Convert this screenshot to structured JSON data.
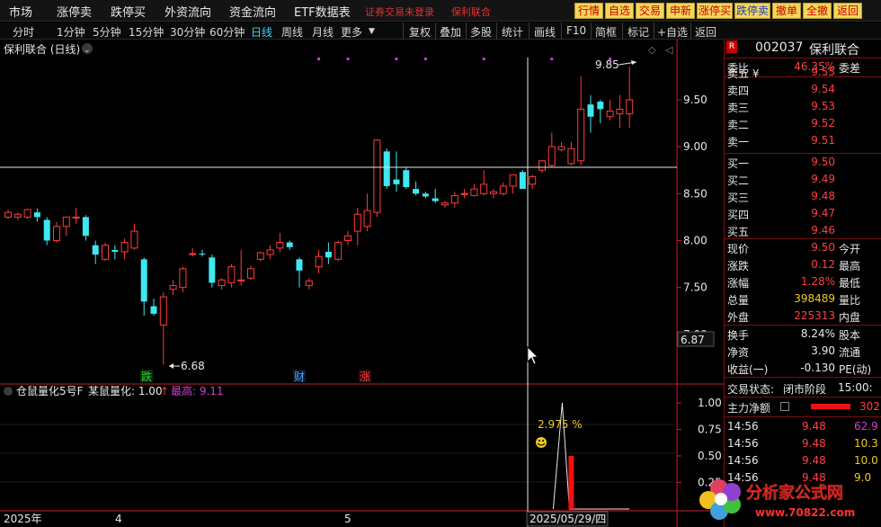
{
  "menubar": {
    "items": [
      "市场",
      "涨停卖",
      "跌停买",
      "外资流向",
      "资金流向",
      "ETF数据表"
    ],
    "notice": "证券交易未登录",
    "stock_tag": "保利联合",
    "buttons": [
      "行情",
      "自选",
      "交易",
      "申新",
      "涨停买",
      "跌停卖",
      "撤单",
      "全撤",
      "返回"
    ]
  },
  "periodbar": {
    "periods": [
      "分时",
      "1分钟",
      "5分钟",
      "15分钟",
      "30分钟",
      "60分钟",
      "日线",
      "周线",
      "月线",
      "更多"
    ],
    "active": "日线",
    "tools": [
      "复权",
      "叠加",
      "多股",
      "统计",
      "画线",
      "F10",
      "简框",
      "标记",
      "+自选",
      "返回"
    ]
  },
  "main_chart": {
    "title": "保利联合 (日线)",
    "high_label": "9.85",
    "low_label": "6.68",
    "crosshair_price": "6.87",
    "markers": [
      "跌",
      "财",
      "涨"
    ]
  },
  "indicator": {
    "name": "仓鼠量化5号F",
    "label1": "某鼠量化: 1.00",
    "arrow": "↑",
    "label2": "最高: 9.11",
    "peak_text": "2.975 %",
    "face": "☺"
  },
  "date_axis": [
    "2025年",
    "4",
    "5"
  ],
  "cursor_date": "2025/05/29/四",
  "colors": {
    "up": "#ff3c3c",
    "down": "#3fe7f0",
    "axis": "#c8202a",
    "ma_dot": "#c040d0",
    "indicator_bar": "#ee1111"
  },
  "chart_data": [
    {
      "type": "candlestick",
      "title": "保利联合 (日线)",
      "y_ticks": [
        7.0,
        7.5,
        8.0,
        8.5,
        9.0,
        9.5
      ],
      "ylim": [
        6.5,
        9.95
      ],
      "candles": [
        {
          "o": 8.25,
          "h": 8.33,
          "l": 8.23,
          "c": 8.3
        },
        {
          "o": 8.25,
          "h": 8.3,
          "l": 8.22,
          "c": 8.28
        },
        {
          "o": 8.25,
          "h": 8.34,
          "l": 8.23,
          "c": 8.33
        },
        {
          "o": 8.3,
          "h": 8.34,
          "l": 8.2,
          "c": 8.25
        },
        {
          "o": 8.22,
          "h": 8.25,
          "l": 7.95,
          "c": 8.0
        },
        {
          "o": 8.0,
          "h": 8.2,
          "l": 7.98,
          "c": 8.15
        },
        {
          "o": 8.15,
          "h": 8.25,
          "l": 8.05,
          "c": 8.25
        },
        {
          "o": 8.25,
          "h": 8.35,
          "l": 8.18,
          "c": 8.25
        },
        {
          "o": 8.25,
          "h": 8.27,
          "l": 8.0,
          "c": 8.05
        },
        {
          "o": 7.95,
          "h": 8.0,
          "l": 7.75,
          "c": 7.85
        },
        {
          "o": 7.8,
          "h": 7.98,
          "l": 7.78,
          "c": 7.95
        },
        {
          "o": 7.9,
          "h": 7.95,
          "l": 7.8,
          "c": 7.88
        },
        {
          "o": 7.88,
          "h": 8.02,
          "l": 7.8,
          "c": 7.98
        },
        {
          "o": 7.92,
          "h": 8.18,
          "l": 7.9,
          "c": 8.1
        },
        {
          "o": 7.8,
          "h": 7.82,
          "l": 7.2,
          "c": 7.35
        },
        {
          "o": 7.3,
          "h": 7.38,
          "l": 7.2,
          "c": 7.22
        },
        {
          "o": 7.1,
          "h": 7.45,
          "l": 6.68,
          "c": 7.4
        },
        {
          "o": 7.48,
          "h": 7.58,
          "l": 7.42,
          "c": 7.52
        },
        {
          "o": 7.5,
          "h": 7.72,
          "l": 7.45,
          "c": 7.7
        },
        {
          "o": 7.85,
          "h": 7.92,
          "l": 7.83,
          "c": 7.86
        },
        {
          "o": 7.86,
          "h": 7.9,
          "l": 7.83,
          "c": 7.85
        },
        {
          "o": 7.82,
          "h": 7.85,
          "l": 7.5,
          "c": 7.55
        },
        {
          "o": 7.52,
          "h": 7.6,
          "l": 7.48,
          "c": 7.58
        },
        {
          "o": 7.55,
          "h": 7.75,
          "l": 7.5,
          "c": 7.72
        },
        {
          "o": 7.58,
          "h": 7.9,
          "l": 7.52,
          "c": 7.58
        },
        {
          "o": 7.6,
          "h": 7.73,
          "l": 7.58,
          "c": 7.7
        },
        {
          "o": 7.8,
          "h": 7.88,
          "l": 7.78,
          "c": 7.87
        },
        {
          "o": 7.85,
          "h": 7.95,
          "l": 7.8,
          "c": 7.9
        },
        {
          "o": 7.92,
          "h": 8.08,
          "l": 7.88,
          "c": 7.98
        },
        {
          "o": 7.98,
          "h": 8.0,
          "l": 7.9,
          "c": 7.93
        },
        {
          "o": 7.8,
          "h": 7.82,
          "l": 7.5,
          "c": 7.68
        },
        {
          "o": 7.52,
          "h": 7.6,
          "l": 7.48,
          "c": 7.57
        },
        {
          "o": 7.72,
          "h": 7.9,
          "l": 7.65,
          "c": 7.83
        },
        {
          "o": 7.88,
          "h": 7.98,
          "l": 7.75,
          "c": 7.82
        },
        {
          "o": 7.8,
          "h": 8.0,
          "l": 7.78,
          "c": 7.98
        },
        {
          "o": 8.0,
          "h": 8.1,
          "l": 7.95,
          "c": 8.05
        },
        {
          "o": 8.1,
          "h": 8.35,
          "l": 7.95,
          "c": 8.28
        },
        {
          "o": 8.15,
          "h": 8.5,
          "l": 8.1,
          "c": 8.32
        },
        {
          "o": 8.3,
          "h": 9.08,
          "l": 8.25,
          "c": 9.07
        },
        {
          "o": 8.95,
          "h": 8.98,
          "l": 8.55,
          "c": 8.58
        },
        {
          "o": 8.65,
          "h": 8.95,
          "l": 8.52,
          "c": 8.6
        },
        {
          "o": 8.75,
          "h": 8.78,
          "l": 8.55,
          "c": 8.57
        },
        {
          "o": 8.55,
          "h": 8.63,
          "l": 8.48,
          "c": 8.5
        },
        {
          "o": 8.5,
          "h": 8.52,
          "l": 8.45,
          "c": 8.47
        },
        {
          "o": 8.45,
          "h": 8.55,
          "l": 8.4,
          "c": 8.42
        },
        {
          "o": 8.38,
          "h": 8.42,
          "l": 8.35,
          "c": 8.4
        },
        {
          "o": 8.4,
          "h": 8.52,
          "l": 8.35,
          "c": 8.48
        },
        {
          "o": 8.5,
          "h": 8.55,
          "l": 8.45,
          "c": 8.5
        },
        {
          "o": 8.48,
          "h": 8.6,
          "l": 8.47,
          "c": 8.55
        },
        {
          "o": 8.5,
          "h": 8.75,
          "l": 8.48,
          "c": 8.6
        },
        {
          "o": 8.5,
          "h": 8.55,
          "l": 8.45,
          "c": 8.52
        },
        {
          "o": 8.5,
          "h": 8.62,
          "l": 8.48,
          "c": 8.58
        },
        {
          "o": 8.58,
          "h": 8.7,
          "l": 8.5,
          "c": 8.7
        },
        {
          "o": 8.73,
          "h": 8.75,
          "l": 8.55,
          "c": 8.55
        },
        {
          "o": 8.6,
          "h": 8.7,
          "l": 8.55,
          "c": 8.68
        },
        {
          "o": 8.75,
          "h": 8.86,
          "l": 8.72,
          "c": 8.85
        },
        {
          "o": 8.8,
          "h": 9.15,
          "l": 8.78,
          "c": 9.0
        },
        {
          "o": 8.97,
          "h": 9.05,
          "l": 8.95,
          "c": 9.0
        },
        {
          "o": 8.82,
          "h": 9.05,
          "l": 8.8,
          "c": 8.98
        },
        {
          "o": 8.85,
          "h": 9.75,
          "l": 8.8,
          "c": 9.4
        },
        {
          "o": 9.45,
          "h": 9.55,
          "l": 9.15,
          "c": 9.32
        },
        {
          "o": 9.48,
          "h": 9.5,
          "l": 9.25,
          "c": 9.4
        },
        {
          "o": 9.32,
          "h": 9.5,
          "l": 9.28,
          "c": 9.38
        },
        {
          "o": 9.35,
          "h": 9.55,
          "l": 9.2,
          "c": 9.4
        },
        {
          "o": 9.35,
          "h": 9.85,
          "l": 9.2,
          "c": 9.5
        }
      ]
    },
    {
      "type": "line",
      "title": "仓鼠量化5号F",
      "y_ticks": [
        0.25,
        0.5,
        0.75,
        1.0
      ],
      "ylim": [
        0,
        1.05
      ],
      "values": [
        0,
        0,
        0,
        0,
        0,
        0,
        0,
        0,
        0,
        0,
        0,
        0,
        0,
        0,
        0,
        0,
        0,
        0,
        0,
        0,
        0,
        0,
        0,
        0,
        0,
        0,
        0,
        0,
        0,
        0,
        0,
        0,
        0,
        0,
        0,
        0,
        0,
        0,
        0,
        0,
        0,
        0,
        0,
        0,
        0,
        0,
        0,
        0,
        0,
        0,
        0,
        0,
        0,
        0,
        0,
        0,
        0,
        0,
        1.0,
        0,
        0,
        0,
        0,
        0,
        0
      ],
      "bar_index": 58,
      "bar_value": 0.5
    }
  ],
  "rightpanel": {
    "code": "002037",
    "name": "保利联合",
    "webi_label": "委比",
    "webi_value": "46.35%",
    "wecha_label": "委差",
    "asks": [
      {
        "label": "卖五",
        "price": "9.55"
      },
      {
        "label": "卖四",
        "price": "9.54"
      },
      {
        "label": "卖三",
        "price": "9.53"
      },
      {
        "label": "卖二",
        "price": "9.52"
      },
      {
        "label": "卖一",
        "price": "9.51"
      }
    ],
    "bids": [
      {
        "label": "买一",
        "price": "9.50"
      },
      {
        "label": "买二",
        "price": "9.49"
      },
      {
        "label": "买三",
        "price": "9.48"
      },
      {
        "label": "买四",
        "price": "9.47"
      },
      {
        "label": "买五",
        "price": "9.46"
      }
    ],
    "stats": [
      {
        "label": "现价",
        "value": "9.50",
        "label2": "今开",
        "color": "red"
      },
      {
        "label": "涨跌",
        "value": "0.12",
        "label2": "最高",
        "color": "red"
      },
      {
        "label": "涨幅",
        "value": "1.28%",
        "label2": "最低",
        "color": "red"
      },
      {
        "label": "总量",
        "value": "398489",
        "label2": "量比",
        "color": "yellow"
      },
      {
        "label": "外盘",
        "value": "225313",
        "label2": "内盘",
        "color": "red"
      }
    ],
    "stats2": [
      {
        "label": "换手",
        "value": "8.24%",
        "label2": "股本",
        "color": "white"
      },
      {
        "label": "净资",
        "value": "3.90",
        "label2": "流通",
        "color": "white"
      },
      {
        "label": "收益(一)",
        "value": "-0.130",
        "label2": "PE(动)",
        "color": "white"
      }
    ],
    "trade_state_label": "交易状态:",
    "trade_state_value": "闭市阶段",
    "trade_state_time": "15:00:",
    "netflow_label": "主力净额",
    "netflow_value": "302",
    "ticks": [
      {
        "time": "14:56",
        "price": "9.48",
        "vol": "62.9"
      },
      {
        "time": "14:56",
        "price": "9.48",
        "vol": "10.3"
      },
      {
        "time": "14:56",
        "price": "9.48",
        "vol": "10.0"
      },
      {
        "time": "14:56",
        "price": "9.48",
        "vol": "9.0"
      }
    ]
  },
  "watermark": {
    "text": "分析家公式网",
    "url": "www.70822.com"
  }
}
